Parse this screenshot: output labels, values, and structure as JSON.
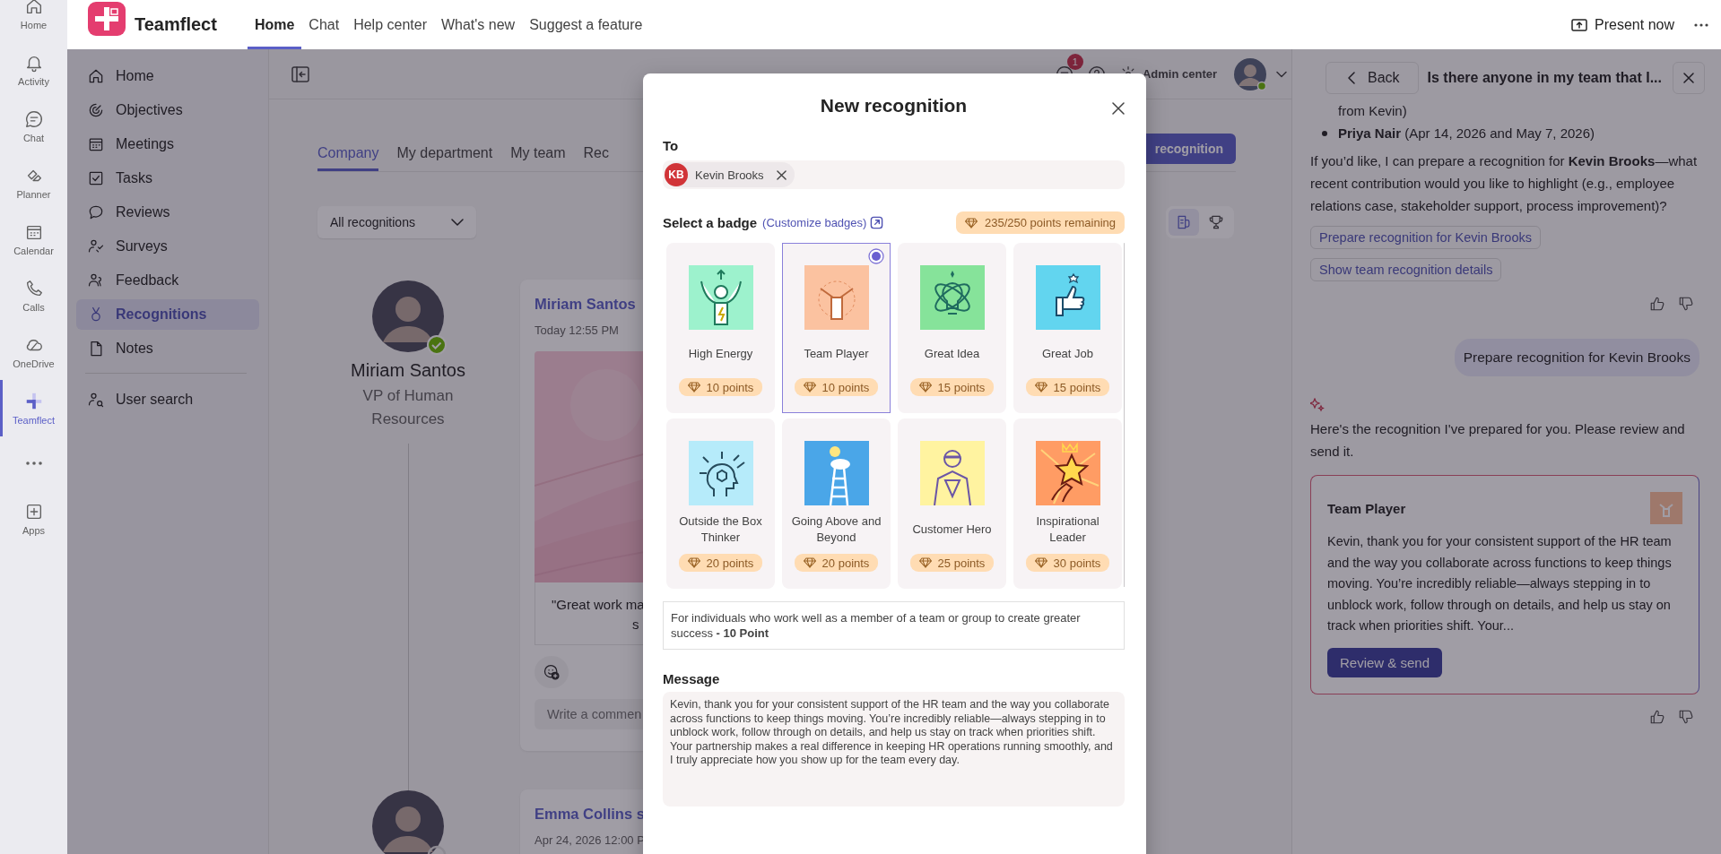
{
  "rail": [
    {
      "kind": "home",
      "label": "Home",
      "selected": false
    },
    {
      "kind": "bell",
      "label": "Activity",
      "selected": false
    },
    {
      "kind": "chat",
      "label": "Chat",
      "selected": false
    },
    {
      "kind": "planner",
      "label": "Planner",
      "selected": false
    },
    {
      "kind": "calendar",
      "label": "Calendar",
      "selected": false
    },
    {
      "kind": "phone",
      "label": "Calls",
      "selected": false
    },
    {
      "kind": "cloud",
      "label": "OneDrive",
      "selected": false
    },
    {
      "kind": "brand",
      "label": "Teamflect",
      "selected": true
    },
    {
      "kind": "more",
      "selected": false
    },
    {
      "kind": "apps",
      "label": "Apps",
      "selected": false
    }
  ],
  "app": {
    "name": "Teamflect",
    "present": "Present now",
    "tabs": [
      {
        "label": "Home",
        "selected": true
      },
      {
        "label": "Chat",
        "selected": false
      },
      {
        "label": "Help center",
        "selected": false
      },
      {
        "label": "What's new",
        "selected": false
      },
      {
        "label": "Suggest a feature",
        "selected": false
      }
    ]
  },
  "sidebar": {
    "items": [
      {
        "kind": "home",
        "label": "Home",
        "selected": false
      },
      {
        "kind": "target",
        "label": "Objectives",
        "selected": false
      },
      {
        "kind": "calendar",
        "label": "Meetings",
        "selected": false
      },
      {
        "kind": "check",
        "label": "Tasks",
        "selected": false
      },
      {
        "kind": "review",
        "label": "Reviews",
        "selected": false
      },
      {
        "kind": "survey",
        "label": "Surveys",
        "selected": false
      },
      {
        "kind": "people",
        "label": "Feedback",
        "selected": false
      },
      {
        "kind": "medal",
        "label": "Recognitions",
        "selected": true
      },
      {
        "kind": "note",
        "label": "Notes",
        "selected": false
      }
    ],
    "footer": [
      {
        "kind": "usersearch",
        "label": "User search",
        "selected": false
      }
    ]
  },
  "toolbar": {
    "notifications": "1",
    "admin": "Admin center"
  },
  "feed_tabs": [
    {
      "label": "Company",
      "selected": true
    },
    {
      "label": "My department",
      "selected": false
    },
    {
      "label": "My team",
      "selected": false
    },
    {
      "label": "Rec",
      "selected": false
    }
  ],
  "new_button": "recognition",
  "filter": "All recognitions",
  "view_toggle": [
    {
      "kind": "list",
      "selected": true
    },
    {
      "kind": "trophy",
      "selected": false
    }
  ],
  "feed": [
    {
      "name": "Miriam Santos",
      "role": "VP of Human Resources",
      "available": true,
      "post": {
        "author": "Miriam Santos",
        "time": "Today 12:55 PM",
        "kind": "picture",
        "quote": [
          "\"Great work ma",
          "s"
        ],
        "comment_placeholder": "Write a commen"
      }
    },
    {
      "available": false,
      "post": {
        "author": "Emma Collins s",
        "time": "Apr 24, 2026 12:00 P"
      }
    }
  ],
  "modal": {
    "title": "New recognition",
    "to_label": "To",
    "recipients": [
      {
        "initials": "KB",
        "name": "Kevin Brooks"
      }
    ],
    "badge_heading": "Select a badge",
    "customize_link": "(Customize badges)",
    "points_remaining": "235/250 points remaining",
    "badges": [
      {
        "kind": "energy",
        "name": "High Energy",
        "points": "10 points",
        "selected": false
      },
      {
        "kind": "team",
        "name": "Team Player",
        "points": "10 points",
        "selected": true
      },
      {
        "kind": "idea",
        "name": "Great Idea",
        "points": "15 points",
        "selected": false
      },
      {
        "kind": "thumb",
        "name": "Great Job",
        "points": "15 points",
        "selected": false
      },
      {
        "kind": "mind",
        "name": "Outside the Box Thinker",
        "points": "20 points",
        "selected": false
      },
      {
        "kind": "ladder",
        "name": "Going Above and Beyond",
        "points": "20 points",
        "selected": false
      },
      {
        "kind": "hero",
        "name": "Customer Hero",
        "points": "25 points",
        "selected": false
      },
      {
        "kind": "star",
        "name": "Inspirational Leader",
        "points": "30 points",
        "selected": false
      }
    ],
    "description": "For individuals who work well as a member of a team or group to create greater success **- 10 Point**",
    "message_label": "Message",
    "message": "Kevin, thank you for your consistent support of the HR team and the way you collaborate across functions to keep things moving. You’re incredibly reliable—always stepping in to unblock work, follow through on details, and help us stay on track when priorities shift. Your partnership makes a real difference in keeping HR operations running smoothly, and I truly appreciate how you show up for the team every day."
  },
  "assistant": {
    "back": "Back",
    "title": "Is there anyone in my team that I...",
    "list_tail": "from Kevin)",
    "bullets": [
      "**Priya Nair** (Apr 14, 2026 and May 7, 2026)"
    ],
    "reply": "If you’d like, I can prepare a recognition for **Kevin Brooks**—what recent contribution would you like to highlight (e.g., employee relations case, stakeholder support, process improvement)?",
    "suggestions": [
      "Prepare recognition for Kevin Brooks",
      "Show team recognition details"
    ],
    "user_message": "Prepare recognition for Kevin Brooks",
    "answer": "Here's the recognition I've prepared for you. Please review and send it.",
    "card": {
      "kind": "team",
      "title": "Team Player",
      "body": "Kevin, thank you for your consistent support of the HR team and the way you collaborate across functions to keep things moving. You’re incredibly reliable—always stepping in to unblock work, follow through on details, and help us stay on track when priorities shift. Your...",
      "button": "Review & send"
    }
  }
}
